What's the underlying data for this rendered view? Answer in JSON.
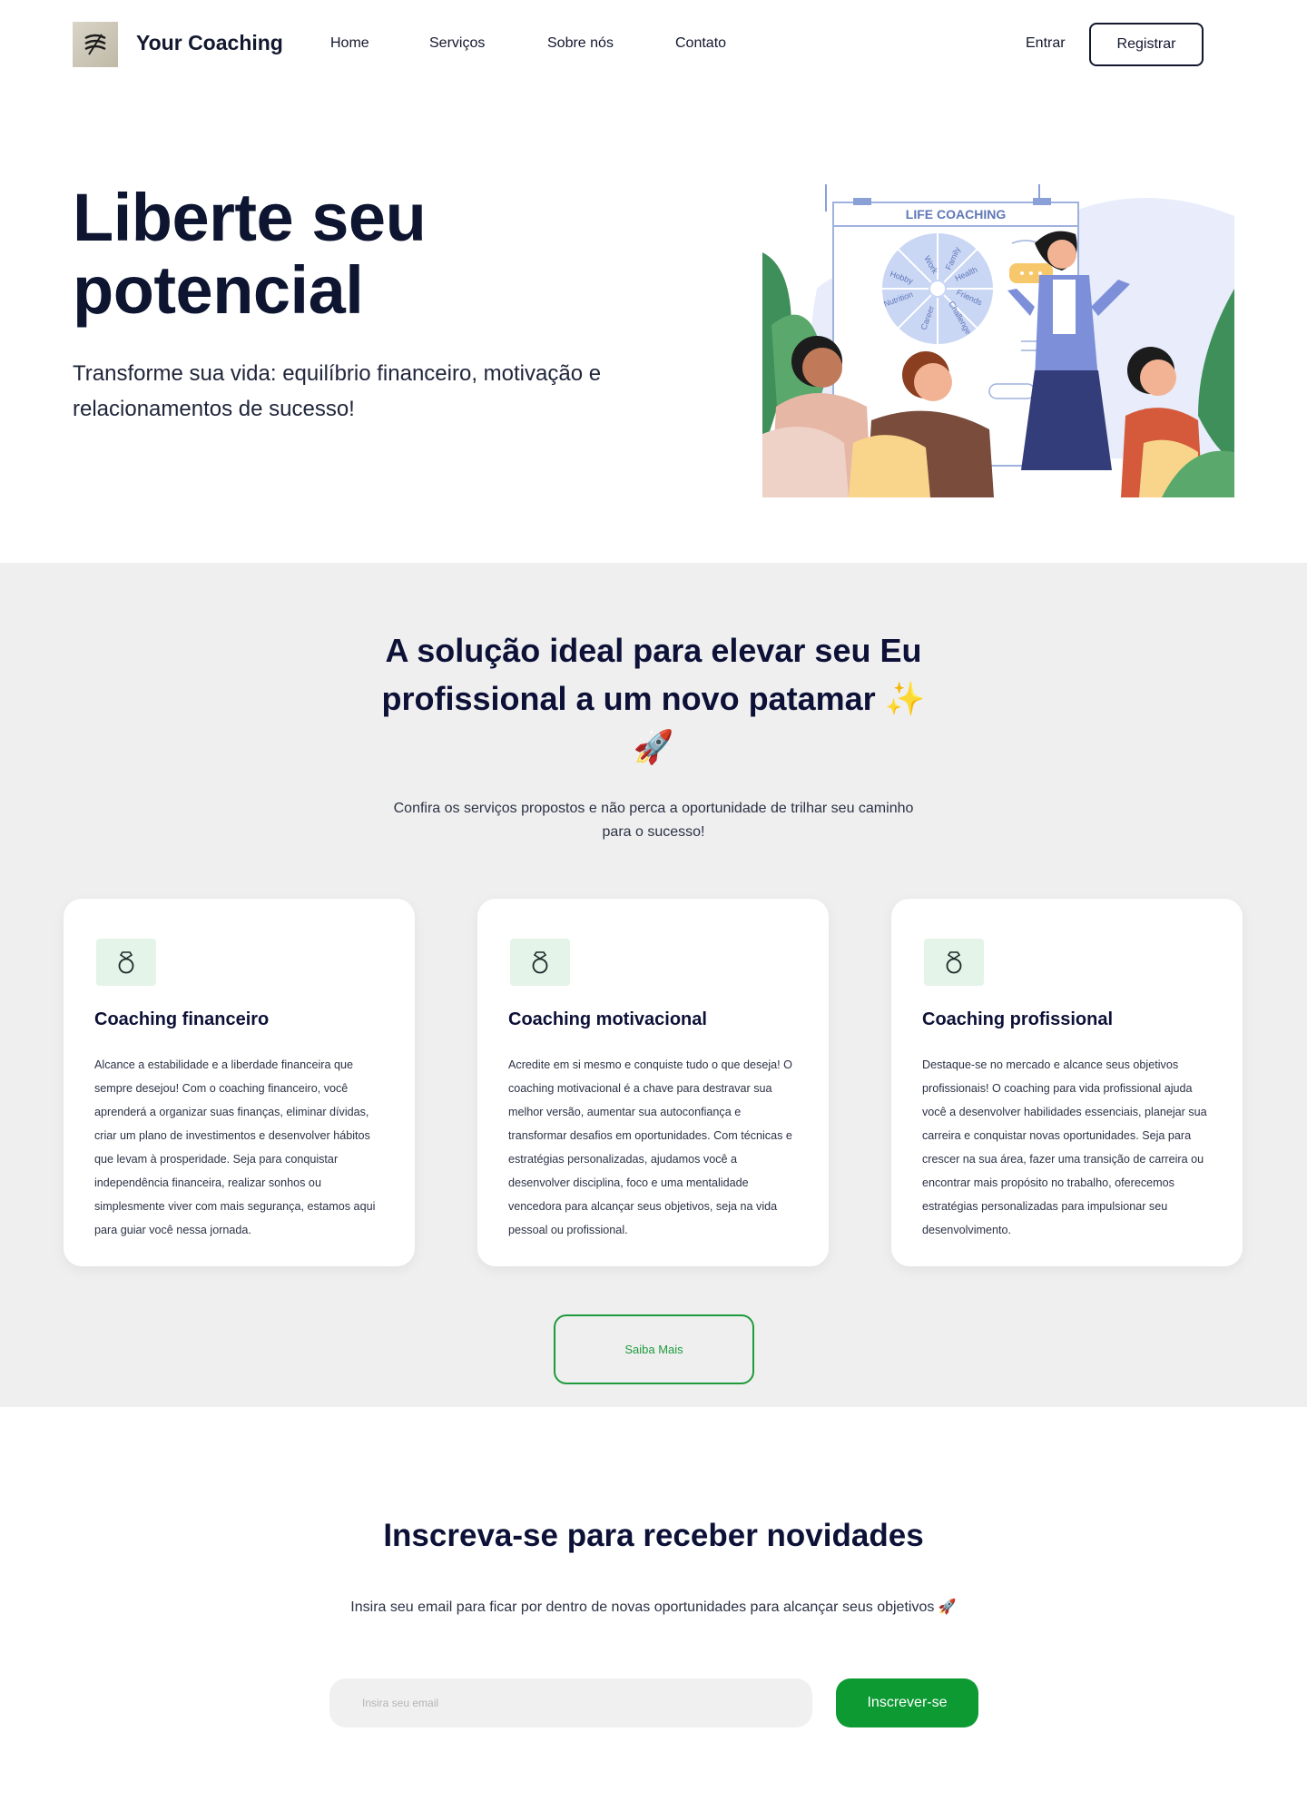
{
  "nav": {
    "brand": "Your Coaching",
    "links": [
      "Home",
      "Serviços",
      "Sobre nós",
      "Contato"
    ],
    "login_label": "Entrar",
    "register_label": "Registrar"
  },
  "hero": {
    "title": "Liberte seu potencial",
    "subtitle": "Transforme sua vida: equilíbrio financeiro, motivação e relacionamentos de sucesso!",
    "illustration": {
      "board_title": "LIFE COACHING",
      "wheel_labels": [
        "Work",
        "Family",
        "Health",
        "Friends",
        "Challenge",
        "Career",
        "Nutrition",
        "Hobby"
      ]
    }
  },
  "services": {
    "title": "A solução ideal para elevar seu Eu profissional a um novo patamar ✨🚀",
    "subtitle": "Confira os serviços propostos e não perca a oportunidade de trilhar seu caminho para o sucesso!",
    "cards": [
      {
        "icon": "ring-icon",
        "title": "Coaching financeiro",
        "text": "Alcance a estabilidade e a liberdade financeira que sempre desejou! Com o coaching financeiro, você aprenderá a organizar suas finanças, eliminar dívidas, criar um plano de investimentos e desenvolver hábitos que levam à prosperidade. Seja para conquistar independência financeira, realizar sonhos ou simplesmente viver com mais segurança, estamos aqui para guiar você nessa jornada."
      },
      {
        "icon": "ring-icon",
        "title": "Coaching motivacional",
        "text": "Acredite em si mesmo e conquiste tudo o que deseja! O coaching motivacional é a chave para destravar sua melhor versão, aumentar sua autoconfiança e transformar desafios em oportunidades. Com técnicas e estratégias personalizadas, ajudamos você a desenvolver disciplina, foco e uma mentalidade vencedora para alcançar seus objetivos, seja na vida pessoal ou profissional."
      },
      {
        "icon": "ring-icon",
        "title": "Coaching profissional",
        "text": "Destaque-se no mercado e alcance seus objetivos profissionais! O coaching para vida profissional ajuda você a desenvolver habilidades essenciais, planejar sua carreira e conquistar novas oportunidades. Seja para crescer na sua área, fazer uma transição de carreira ou encontrar mais propósito no trabalho, oferecemos estratégias personalizadas para impulsionar seu desenvolvimento."
      }
    ],
    "cta_label": "Saiba Mais"
  },
  "newsletter": {
    "title": "Inscreva-se para receber novidades",
    "subtitle": "Insira seu email para ficar por dentro de novas oportunidades para alcançar seus objetivos 🚀",
    "input_placeholder": "Insira seu email",
    "button_label": "Inscrever-se"
  },
  "colors": {
    "primary_text": "#0d1137",
    "accent_green": "#0d9a33",
    "section_bg": "#efefef",
    "icon_bg": "#e4f4e8"
  }
}
